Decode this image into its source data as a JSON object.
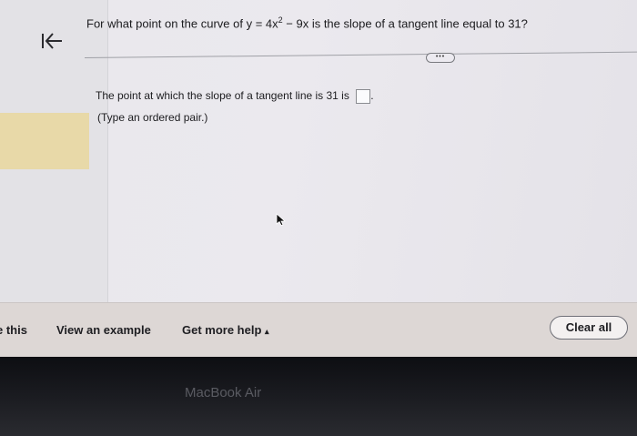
{
  "question": {
    "prefix": "For what point on the curve of y = 4x",
    "exponent": "2",
    "suffix": " − 9x is the slope of a tangent line equal to 31?"
  },
  "more_button": {
    "label": "•••"
  },
  "answer": {
    "prompt": "The point at which the slope of a tangent line is 31 is",
    "trailing": ".",
    "value": "",
    "hint": "(Type an ordered pair.)"
  },
  "bottom_bar": {
    "partial_left": "e this",
    "view_example": "View an example",
    "get_more_help": "Get more help",
    "help_caret": "▴",
    "clear_all": "Clear all"
  },
  "bezel": {
    "brand": "MacBook Air"
  },
  "icons": {
    "back": "first-page-arrow-icon",
    "cursor": "mouse-pointer-icon"
  },
  "colors": {
    "highlight": "#e8d9a8",
    "bar": "#ddd7d5",
    "bezel": "#0d0e12"
  }
}
